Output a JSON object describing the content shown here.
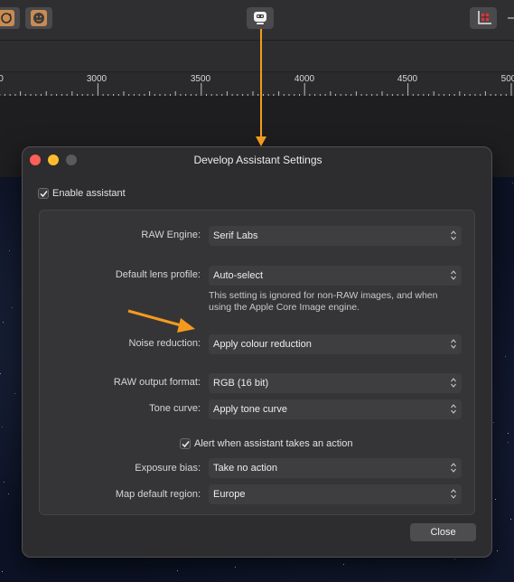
{
  "ruler": {
    "ticks": [
      "0",
      "3000",
      "3500",
      "4000",
      "4500",
      "500"
    ]
  },
  "dialog": {
    "title": "Develop Assistant Settings",
    "enable_label": "Enable assistant",
    "raw_engine": {
      "label": "RAW Engine:",
      "value": "Serif Labs"
    },
    "lens_profile": {
      "label": "Default lens profile:",
      "value": "Auto-select",
      "note_line1": "This setting is ignored for non-RAW images, and when",
      "note_line2": "using the Apple Core Image engine."
    },
    "noise_reduction": {
      "label": "Noise reduction:",
      "value": "Apply colour reduction"
    },
    "raw_output": {
      "label": "RAW output format:",
      "value": "RGB (16 bit)"
    },
    "tone_curve": {
      "label": "Tone curve:",
      "value": "Apply tone curve"
    },
    "alert_label": "Alert when assistant takes an action",
    "exposure_bias": {
      "label": "Exposure bias:",
      "value": "Take no action"
    },
    "map_region": {
      "label": "Map default region:",
      "value": "Europe"
    },
    "close_label": "Close"
  },
  "colors": {
    "annotation_arrow": "#f39a1e",
    "traffic_red": "#ff5f57",
    "traffic_yellow": "#febc2e",
    "traffic_gray": "#5a5a5d"
  },
  "icons": [
    "toolbar-rotate-icon",
    "toolbar-face-icon",
    "develop-assistant-icon",
    "crop-grid-icon",
    "chevron-updown-icon",
    "checkmark-icon",
    "annotation-arrow-icon"
  ]
}
